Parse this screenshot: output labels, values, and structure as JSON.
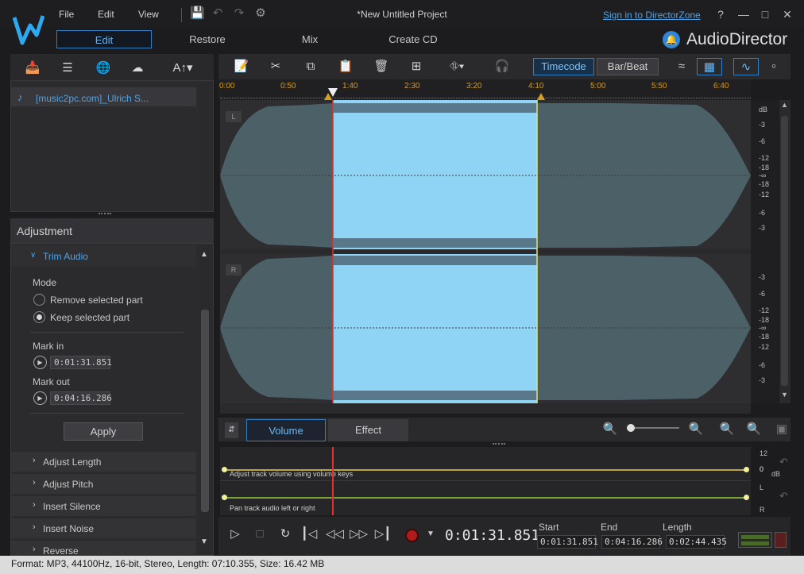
{
  "menu": {
    "file": "File",
    "edit": "Edit",
    "view": "View"
  },
  "window": {
    "title": "*New Untitled Project",
    "sign_in": "Sign in to DirectorZone",
    "help": "?"
  },
  "mode_tabs": [
    "Edit",
    "Restore",
    "Mix",
    "Create CD"
  ],
  "brand": "AudioDirector",
  "library": {
    "items": [
      {
        "name": "[music2pc.com]_Ulrich S..."
      }
    ]
  },
  "adjustment": {
    "header": "Adjustment",
    "trim_title": "Trim Audio",
    "mode_label": "Mode",
    "mode_options": [
      "Remove selected part",
      "Keep selected part"
    ],
    "mode_selected": "Keep selected part",
    "mark_in_label": "Mark in",
    "mark_in_value": "0:01:31.851",
    "mark_out_label": "Mark out",
    "mark_out_value": "0:04:16.286",
    "apply_label": "Apply",
    "sections": [
      "Adjust Length",
      "Adjust Pitch",
      "Insert Silence",
      "Insert Noise",
      "Reverse"
    ]
  },
  "toolbar": {
    "timecode": "Timecode",
    "barbeat": "Bar/Beat"
  },
  "ruler_ticks": [
    "0:00",
    "0:50",
    "1:40",
    "2:30",
    "3:20",
    "4:10",
    "5:00",
    "5:50",
    "6:40"
  ],
  "db_scale": {
    "header": "dB",
    "left": [
      "-3",
      "-6",
      "-12",
      "-18",
      "-∞",
      "-18",
      "-12",
      "-6",
      "-3"
    ],
    "right": [
      "-3",
      "-6",
      "-12",
      "-18",
      "-∞",
      "-18",
      "-12",
      "-6",
      "-3"
    ]
  },
  "channels": {
    "left": "L",
    "right": "R"
  },
  "lower_tabs": {
    "volume": "Volume",
    "effect": "Effect"
  },
  "envelope": {
    "volume_hint": "Adjust track volume using volume keys",
    "pan_hint": "Pan track audio left or right",
    "vol_scale": [
      "12",
      "0",
      "dB"
    ],
    "pan_scale": [
      "L",
      "R"
    ]
  },
  "transport": {
    "current_time": "0:01:31.851",
    "start_label": "Start",
    "start_value": "0:01:31.851",
    "end_label": "End",
    "end_value": "0:04:16.286",
    "length_label": "Length",
    "length_value": "0:02:44.435"
  },
  "status": "Format: MP3, 44100Hz, 16-bit, Stereo, Length: 07:10.355, Size: 16.42 MB",
  "colors": {
    "selection": "#8fd3f5",
    "wave_unselected": "#4c6068",
    "accent": "#2f86d8",
    "playhead": "#e03030"
  }
}
